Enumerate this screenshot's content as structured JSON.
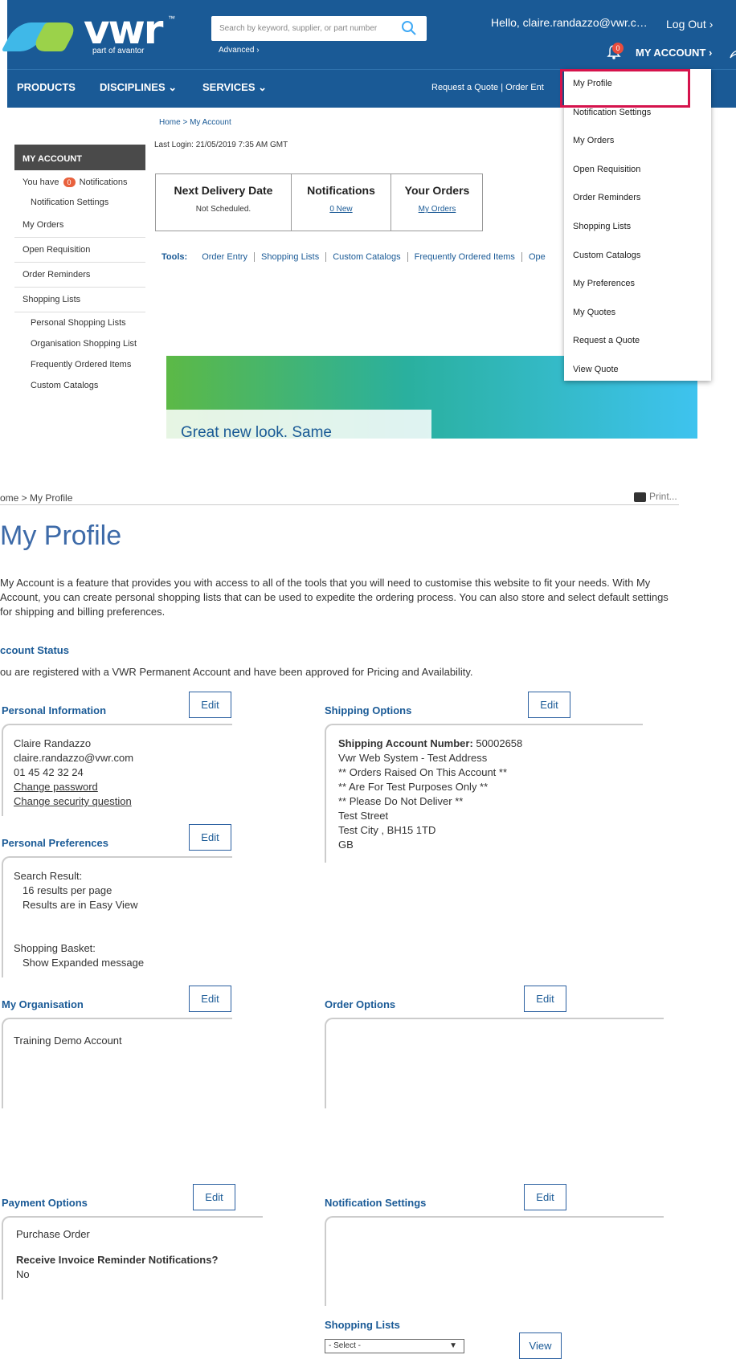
{
  "header": {
    "brand": "vwr",
    "brand_tm": "™",
    "brand_sub": "part of avantor",
    "search_placeholder": "Search by keyword, supplier, or part number",
    "advanced": "Advanced ›",
    "hello": "Hello,  claire.randazzo@vwr.c…",
    "logout": "Log Out ›",
    "notif_count": "0",
    "my_account": "MY ACCOUNT ›"
  },
  "nav": {
    "products": "PRODUCTS",
    "disciplines": "DISCIPLINES ⌄",
    "services": "SERVICES ⌄",
    "right": "Request a Quote  |  Order Ent"
  },
  "top": {
    "breadcrumb": "Home  > My Account",
    "last_login": "Last Login:  21/05/2019 7:35 AM GMT"
  },
  "sidebar": {
    "heading": "MY ACCOUNT",
    "you_have": "You have",
    "notif_badge": "0",
    "notifications": "Notifications",
    "items": [
      {
        "label": "Notification Settings",
        "sub": true
      },
      {
        "label": "My Orders",
        "sub": false
      },
      {
        "label": "Open Requisition",
        "sub": false
      },
      {
        "label": "Order Reminders",
        "sub": false
      },
      {
        "label": "Shopping Lists",
        "sub": false
      },
      {
        "label": "Personal Shopping Lists",
        "sub": true
      },
      {
        "label": "Organisation Shopping List",
        "sub": true
      },
      {
        "label": "Frequently Ordered Items",
        "sub": true
      },
      {
        "label": "Custom Catalogs",
        "sub": true
      }
    ]
  },
  "summary": {
    "delivery_title": "Next Delivery Date",
    "delivery_value": "Not Scheduled.",
    "notif_title": "Notifications",
    "notif_value": "0  New",
    "orders_title": "Your Orders",
    "orders_value": "My Orders"
  },
  "tools": {
    "label": "Tools:",
    "items": [
      "Order Entry",
      "Shopping Lists",
      "Custom Catalogs",
      "Frequently Ordered Items",
      "Ope"
    ]
  },
  "banner": {
    "headline": "Great new look. Same"
  },
  "dropdown": {
    "items": [
      "My Profile",
      "Notification Settings",
      "My Orders",
      "Open Requisition",
      "Order Reminders",
      "Shopping Lists",
      "Custom Catalogs",
      "My Preferences",
      "My Quotes",
      "Request a Quote",
      "View Quote"
    ],
    "highlight_color": "#d5134c"
  },
  "profile": {
    "breadcrumb": "ome > My Profile",
    "print": "Print...",
    "title": "My Profile",
    "intro": "My Account is a feature that provides you with access to all of the tools that you will need to customise this website to fit your needs. With My Account, you can create personal shopping lists that can be used to expedite the ordering process. You can also store and select default settings for shipping and billing preferences.",
    "account_status_heading": "ccount Status",
    "account_status_text": "ou are registered with a VWR Permanent Account and have been approved for Pricing and Availability.",
    "edit_label": "Edit",
    "view_label": "View",
    "personal_info": {
      "heading": "Personal Information",
      "name": "Claire Randazzo",
      "email": "claire.randazzo@vwr.com",
      "phone": "01 45 42 32 24",
      "change_password": "Change password",
      "change_security": "Change security question"
    },
    "shipping": {
      "heading": "Shipping Options",
      "account_label": "Shipping Account Number:",
      "account_number": "50002658",
      "lines": [
        "Vwr Web System - Test Address",
        "** Orders Raised On This Account **",
        "** Are For Test Purposes Only **",
        "** Please Do Not Deliver **",
        "Test Street",
        "Test City , BH15 1TD",
        "GB"
      ]
    },
    "preferences": {
      "heading": "Personal Preferences",
      "search_result": "Search Result:",
      "per_page": "16 results per page",
      "view": "Results are in Easy View",
      "basket": "Shopping Basket:",
      "basket_msg": "Show Expanded message"
    },
    "organisation": {
      "heading": "My Organisation",
      "name": "Training Demo Account"
    },
    "order_options": {
      "heading": "Order Options"
    },
    "payment": {
      "heading": "Payment Options",
      "method": "Purchase Order",
      "reminder_q": "Receive Invoice Reminder Notifications?",
      "reminder_a": "No"
    },
    "notification_settings": {
      "heading": "Notification Settings"
    },
    "shopping_lists": {
      "heading": "Shopping Lists",
      "select": "- Select -"
    }
  }
}
